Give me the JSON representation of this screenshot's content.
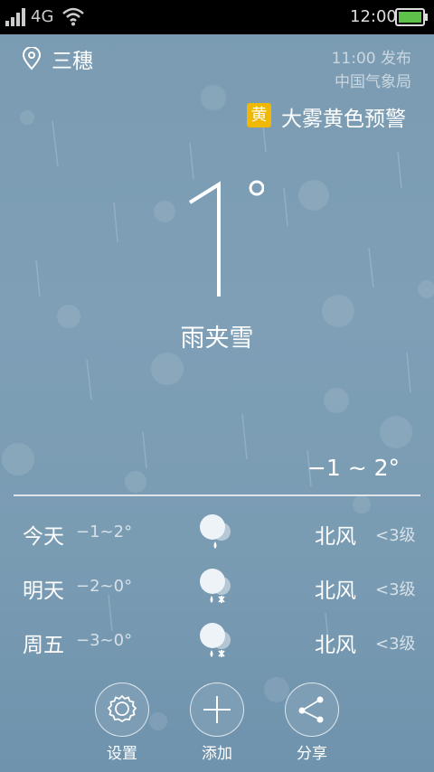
{
  "status_bar": {
    "network": "4G",
    "time": "12:00"
  },
  "location": {
    "name": "三穗"
  },
  "publish": {
    "time": "11:00 发布",
    "source": "中国气象局"
  },
  "warning": {
    "badge": "黄",
    "text": "大雾黄色预警",
    "color": "#f0b800"
  },
  "current": {
    "temperature": "1",
    "description": "雨夹雪",
    "range": "−1 ~ 2°"
  },
  "forecast": [
    {
      "day": "今天",
      "temp": "−1~2°",
      "icon": "rain-cloud-icon",
      "wind": "北风",
      "level": "<3级"
    },
    {
      "day": "明天",
      "temp": "−2~0°",
      "icon": "sleet-cloud-icon",
      "wind": "北风",
      "level": "<3级"
    },
    {
      "day": "周五",
      "temp": "−3~0°",
      "icon": "sleet-cloud-icon",
      "wind": "北风",
      "level": "<3级"
    }
  ],
  "actions": [
    {
      "label": "设置",
      "icon": "gear-icon"
    },
    {
      "label": "添加",
      "icon": "plus-icon"
    },
    {
      "label": "分享",
      "icon": "share-icon"
    }
  ]
}
